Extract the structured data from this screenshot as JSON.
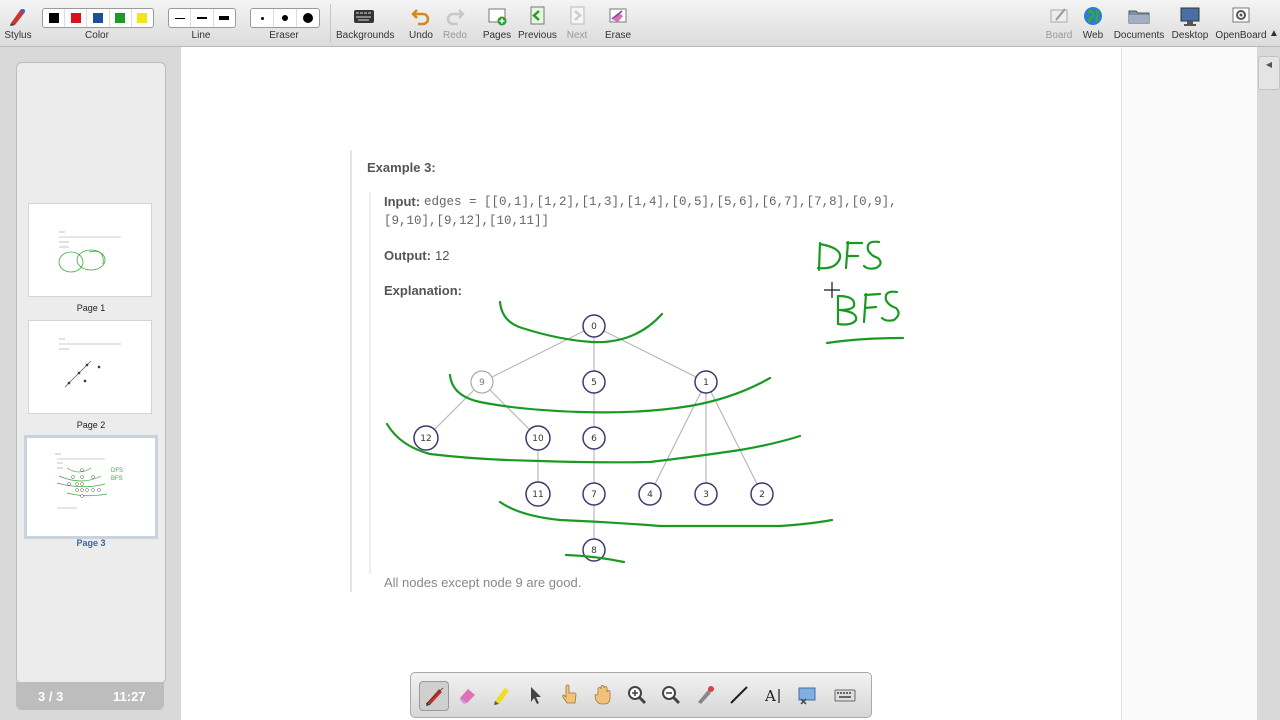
{
  "toolbar": {
    "stylus": "Stylus",
    "color": "Color",
    "line": "Line",
    "eraser": "Eraser",
    "backgrounds": "Backgrounds",
    "undo": "Undo",
    "redo": "Redo",
    "pages": "Pages",
    "previous": "Previous",
    "next": "Next",
    "erase": "Erase",
    "board": "Board",
    "web": "Web",
    "documents": "Documents",
    "desktop": "Desktop",
    "openboard": "OpenBoard",
    "colors": [
      "#000000",
      "#d8141a",
      "#1f4e9c",
      "#1e9c2a",
      "#f2e617"
    ]
  },
  "pages_panel": {
    "pages": [
      {
        "label": "Page 1"
      },
      {
        "label": "Page 2"
      },
      {
        "label": "Page 3"
      }
    ],
    "page_counter": "3 / 3",
    "clock": "11:27"
  },
  "content": {
    "example_title": "Example 3:",
    "input_label": "Input:",
    "input_line1": "edges = [[0,1],[1,2],[1,3],[1,4],[0,5],[5,6],[6,7],[7,8],[0,9],",
    "input_line2": "[9,10],[9,12],[10,11]]",
    "output_label": "Output:",
    "output_value": "12",
    "explanation_label": "Explanation:",
    "footer": "All nodes except node 9 are good.",
    "nodes": [
      "0",
      "9",
      "5",
      "1",
      "12",
      "10",
      "6",
      "11",
      "7",
      "4",
      "3",
      "2",
      "8"
    ],
    "annotations": [
      "DFS",
      "BFS"
    ]
  },
  "dock_tools": [
    "pen-icon",
    "eraser-icon",
    "highlighter-icon",
    "pointer-icon",
    "hand-pointer-icon",
    "hand-icon",
    "zoom-in-icon",
    "zoom-out-icon",
    "laser-icon",
    "line-icon",
    "text-icon",
    "capture-icon",
    "keyboard-icon"
  ],
  "theme": {
    "ink_green": "#1a9a22",
    "node_stroke": "#3a3a6e",
    "toolbar_bg": "#e4e4e4"
  }
}
